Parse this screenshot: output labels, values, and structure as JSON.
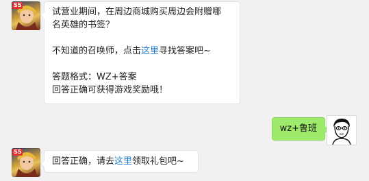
{
  "messages": [
    {
      "sender": "bot",
      "badge": "S5",
      "lines_top": [
        "试营业期间，在周边商城购买周边会附赠哪",
        "名英雄的书签？"
      ],
      "prompt_before": "不知道的召唤师，点击",
      "prompt_link": "这里",
      "prompt_after": "寻找答案吧~",
      "format_line": "答题格式：WZ+答案",
      "reward_line": "回答正确可获得游戏奖励哦！"
    },
    {
      "sender": "user",
      "text": "wz+鲁班"
    },
    {
      "sender": "bot",
      "badge": "S5",
      "before": "回答正确，请去",
      "link": "这里",
      "after": "领取礼包吧~"
    }
  ],
  "colors": {
    "background": "#f1f1f1",
    "bubble_left": "#ffffff",
    "bubble_right": "#9eea6a",
    "link": "#1f7fd0"
  },
  "icons": [
    "bot-avatar-icon",
    "user-avatar-icon"
  ]
}
